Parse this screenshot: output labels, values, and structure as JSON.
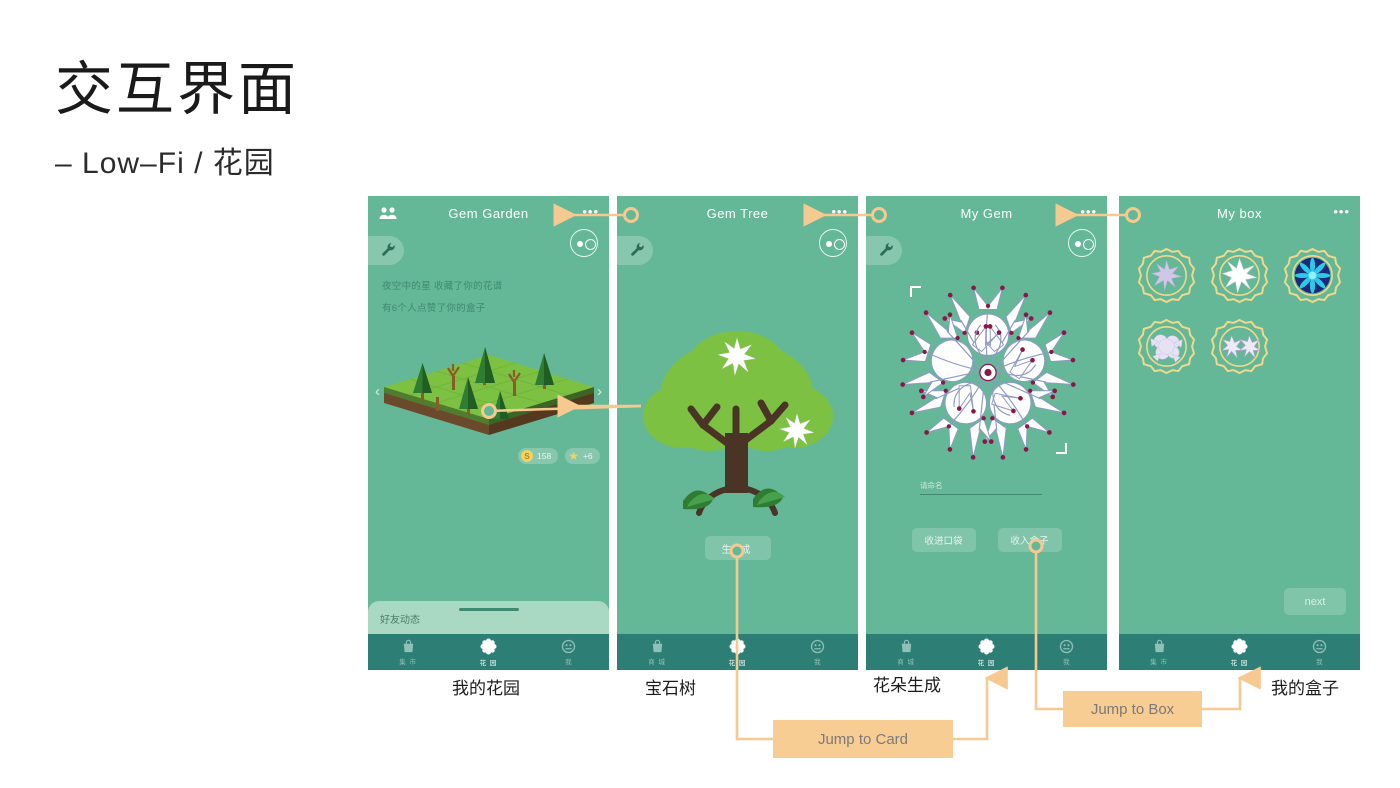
{
  "title": "交互界面",
  "subtitle": "– Low–Fi / 花园",
  "screens": [
    {
      "id": "my-garden",
      "header_title": "Gem Garden",
      "more_dots": "•••",
      "feed": [
        "夜空中的星 收藏了你的花谱",
        "有6个人点赞了你的盒子"
      ],
      "coin_value": "158",
      "coin_symbol": "S",
      "star_value": "+6",
      "chev_left": "‹",
      "chev_right": "›",
      "friend_sheet_label": "好友动态",
      "caption": "我的花园",
      "tabs": [
        {
          "label": "集 市",
          "icon": "bag-icon",
          "active": false
        },
        {
          "label": "花 园",
          "icon": "flower-gear-icon",
          "active": true
        },
        {
          "label": "我",
          "icon": "face-icon",
          "active": false
        }
      ]
    },
    {
      "id": "gem-tree",
      "header_title": "Gem Tree",
      "more_dots": "•••",
      "generate_label": "生 成",
      "caption": "宝石树",
      "tabs": [
        {
          "label": "商 城",
          "icon": "bag-icon",
          "active": false
        },
        {
          "label": "花 园",
          "icon": "flower-gear-icon",
          "active": true
        },
        {
          "label": "我",
          "icon": "face-icon",
          "active": false
        }
      ]
    },
    {
      "id": "my-gem",
      "header_title": "My Gem",
      "more_dots": "•••",
      "name_placeholder": "请命名",
      "buttons": [
        "收进口袋",
        "收入盒子"
      ],
      "caption": "花朵生成",
      "tabs": [
        {
          "label": "商 城",
          "icon": "bag-icon",
          "active": false
        },
        {
          "label": "花 园",
          "icon": "flower-gear-icon",
          "active": true
        },
        {
          "label": "我",
          "icon": "face-icon",
          "active": false
        }
      ]
    },
    {
      "id": "my-box",
      "header_title": "My box",
      "more_dots": "•••",
      "next_label": "next",
      "caption": "我的盒子",
      "items": [
        {
          "name": "gem-badge-1",
          "style": "snowflake-violet"
        },
        {
          "name": "gem-badge-2",
          "style": "snowflake-white"
        },
        {
          "name": "gem-badge-3",
          "style": "burst-blue"
        },
        {
          "name": "gem-badge-4",
          "style": "cluster-lavender"
        },
        {
          "name": "gem-badge-5",
          "style": "twin-violet"
        }
      ]
    }
  ],
  "flows": [
    {
      "id": "jump-to-card",
      "label": "Jump to Card"
    },
    {
      "id": "jump-to-box",
      "label": "Jump to Box"
    }
  ],
  "colors": {
    "screen_bg": "#64b897",
    "tabbar": "#2d7f75",
    "accent_orange": "#f8cd94",
    "sheet": "#a9d9c2",
    "coin": "#f6d060"
  }
}
